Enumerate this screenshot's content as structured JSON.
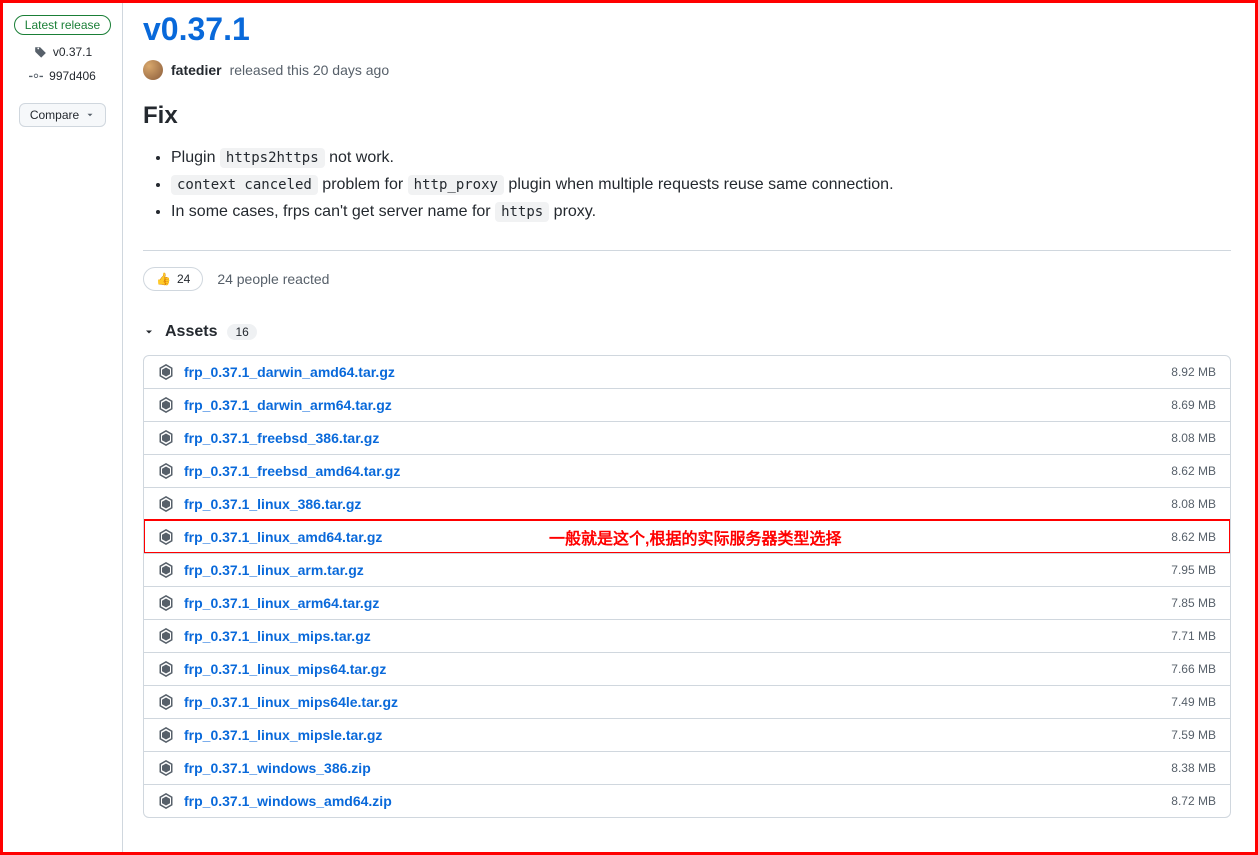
{
  "side": {
    "latest_label": "Latest release",
    "tag": "v0.37.1",
    "commit": "997d406",
    "compare_label": "Compare"
  },
  "release": {
    "title": "v0.37.1",
    "author": "fatedier",
    "released_text": "released this 20 days ago"
  },
  "notes": {
    "heading": "Fix",
    "items": [
      {
        "pre": "Plugin ",
        "code": "https2https",
        "mid": " not work.",
        "code2": null,
        "post": null
      },
      {
        "pre": "",
        "code": "context canceled",
        "mid": " problem for ",
        "code2": "http_proxy",
        "post": " plugin when multiple requests reuse same connection."
      },
      {
        "pre": "In some cases, frps can't get server name for ",
        "code": "https",
        "mid": " proxy.",
        "code2": null,
        "post": null
      }
    ]
  },
  "reactions": {
    "emoji": "👍",
    "count": "24",
    "summary": "24 people reacted"
  },
  "assets": {
    "label": "Assets",
    "count": "16",
    "annotation": "一般就是这个,根据的实际服务器类型选择",
    "highlight_index": 5,
    "items": [
      {
        "name": "frp_0.37.1_darwin_amd64.tar.gz",
        "size": "8.92 MB"
      },
      {
        "name": "frp_0.37.1_darwin_arm64.tar.gz",
        "size": "8.69 MB"
      },
      {
        "name": "frp_0.37.1_freebsd_386.tar.gz",
        "size": "8.08 MB"
      },
      {
        "name": "frp_0.37.1_freebsd_amd64.tar.gz",
        "size": "8.62 MB"
      },
      {
        "name": "frp_0.37.1_linux_386.tar.gz",
        "size": "8.08 MB"
      },
      {
        "name": "frp_0.37.1_linux_amd64.tar.gz",
        "size": "8.62 MB"
      },
      {
        "name": "frp_0.37.1_linux_arm.tar.gz",
        "size": "7.95 MB"
      },
      {
        "name": "frp_0.37.1_linux_arm64.tar.gz",
        "size": "7.85 MB"
      },
      {
        "name": "frp_0.37.1_linux_mips.tar.gz",
        "size": "7.71 MB"
      },
      {
        "name": "frp_0.37.1_linux_mips64.tar.gz",
        "size": "7.66 MB"
      },
      {
        "name": "frp_0.37.1_linux_mips64le.tar.gz",
        "size": "7.49 MB"
      },
      {
        "name": "frp_0.37.1_linux_mipsle.tar.gz",
        "size": "7.59 MB"
      },
      {
        "name": "frp_0.37.1_windows_386.zip",
        "size": "8.38 MB"
      },
      {
        "name": "frp_0.37.1_windows_amd64.zip",
        "size": "8.72 MB"
      }
    ]
  }
}
